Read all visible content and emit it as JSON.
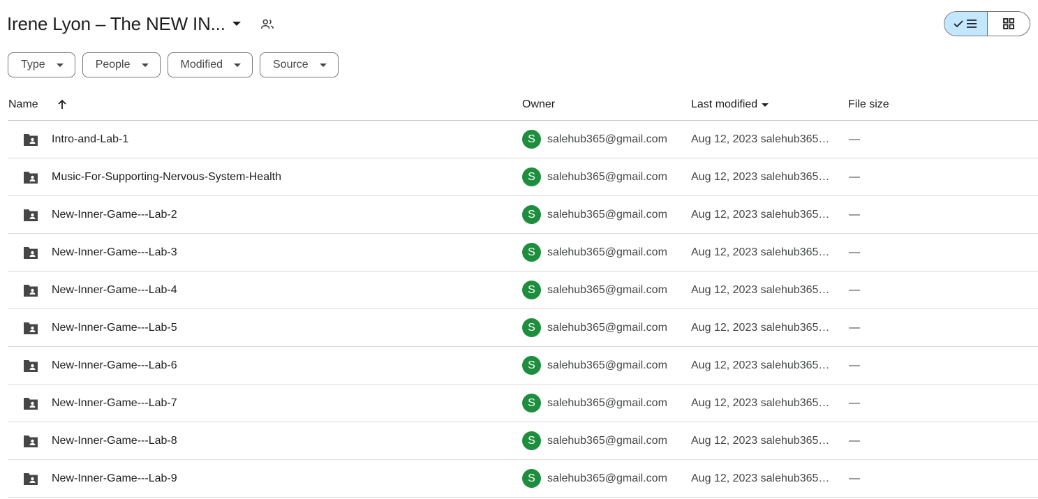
{
  "header": {
    "title": "Irene Lyon – The NEW IN...",
    "icons": {
      "shared": "shared-people-icon",
      "title_dropdown": "caret-down-icon"
    },
    "view_toggle": {
      "list_icon": "list-view-check-icon",
      "grid_icon": "grid-view-icon",
      "selected": "list"
    }
  },
  "filters": [
    {
      "label": "Type"
    },
    {
      "label": "People"
    },
    {
      "label": "Modified"
    },
    {
      "label": "Source"
    }
  ],
  "table": {
    "columns": {
      "name": "Name",
      "owner": "Owner",
      "last_modified": "Last modified",
      "file_size": "File size"
    },
    "sort_icon": "arrow-up-icon",
    "rows": [
      {
        "name": "Intro-and-Lab-1",
        "avatar": "S",
        "owner": "salehub365@gmail.com",
        "modified": "Aug 12, 2023 salehub365@...",
        "size": "—"
      },
      {
        "name": "Music-For-Supporting-Nervous-System-Health",
        "avatar": "S",
        "owner": "salehub365@gmail.com",
        "modified": "Aug 12, 2023 salehub365@...",
        "size": "—"
      },
      {
        "name": "New-Inner-Game---Lab-2",
        "avatar": "S",
        "owner": "salehub365@gmail.com",
        "modified": "Aug 12, 2023 salehub365@...",
        "size": "—"
      },
      {
        "name": "New-Inner-Game---Lab-3",
        "avatar": "S",
        "owner": "salehub365@gmail.com",
        "modified": "Aug 12, 2023 salehub365@...",
        "size": "—"
      },
      {
        "name": "New-Inner-Game---Lab-4",
        "avatar": "S",
        "owner": "salehub365@gmail.com",
        "modified": "Aug 12, 2023 salehub365@...",
        "size": "—"
      },
      {
        "name": "New-Inner-Game---Lab-5",
        "avatar": "S",
        "owner": "salehub365@gmail.com",
        "modified": "Aug 12, 2023 salehub365@...",
        "size": "—"
      },
      {
        "name": "New-Inner-Game---Lab-6",
        "avatar": "S",
        "owner": "salehub365@gmail.com",
        "modified": "Aug 12, 2023 salehub365@...",
        "size": "—"
      },
      {
        "name": "New-Inner-Game---Lab-7",
        "avatar": "S",
        "owner": "salehub365@gmail.com",
        "modified": "Aug 12, 2023 salehub365@...",
        "size": "—"
      },
      {
        "name": "New-Inner-Game---Lab-8",
        "avatar": "S",
        "owner": "salehub365@gmail.com",
        "modified": "Aug 12, 2023 salehub365@...",
        "size": "—"
      },
      {
        "name": "New-Inner-Game---Lab-9",
        "avatar": "S",
        "owner": "salehub365@gmail.com",
        "modified": "Aug 12, 2023 salehub365@...",
        "size": "—"
      }
    ]
  },
  "colors": {
    "avatar_bg": "#1e8e3e",
    "view_toggle_selected_bg": "#c2e7ff",
    "folder_icon": "#444746"
  }
}
